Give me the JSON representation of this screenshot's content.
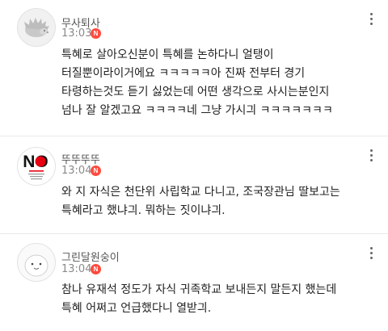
{
  "comments": [
    {
      "nickname": "무사퇴사",
      "time": "13:03",
      "new_badge": "N",
      "lines": [
        "특혜로 살아오신분이 특혜를 논하다니 얼탱이",
        "터질뿐이라이거에요 ㅋㅋㅋㅋㅋ아 진짜 전부터 경기",
        "타령하는것도 듣기 싫었는데 어떤 생각으로 사시는분인지",
        "넘나 잘 알겠고요 ㅋㅋㅋㅋ네 그냥 가시긔 ㅋㅋㅋㅋㅋㅋㅋ"
      ]
    },
    {
      "nickname": "뚜뚜뚜뚜",
      "time": "13:04",
      "new_badge": "N",
      "avatar_text": "NO",
      "lines": [
        "와 지 자식은 천단위 사립학교 다니고, 조국장관님 딸보고는",
        "특혜라고 했냐긔. 뭐하는 짓이냐긔."
      ]
    },
    {
      "nickname": "그린달원숭이",
      "time": "13:04",
      "new_badge": "N",
      "lines": [
        "참나 유재석 정도가 자식 귀족학교 보내든지 말든지 했는데",
        "특혜 어쩌고 언급했다니 열받긔."
      ]
    }
  ],
  "colors": {
    "badge": "#ff4b3e",
    "no_red": "#e60012"
  }
}
